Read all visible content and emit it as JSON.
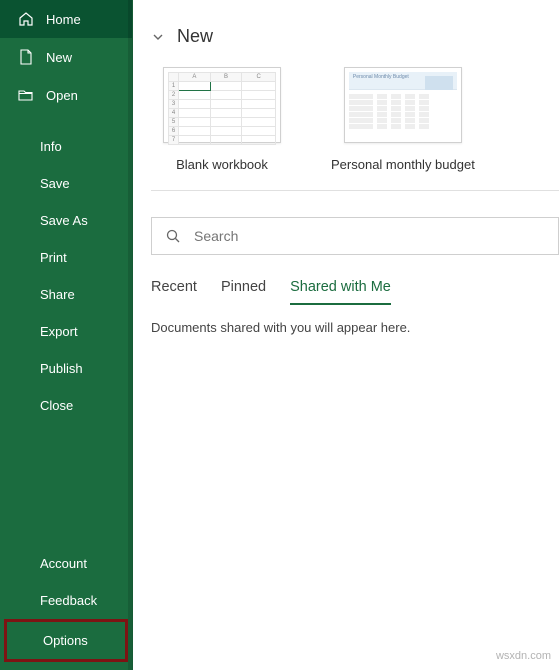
{
  "sidebar": {
    "home": "Home",
    "new": "New",
    "open": "Open",
    "info": "Info",
    "save": "Save",
    "save_as": "Save As",
    "print": "Print",
    "share": "Share",
    "export": "Export",
    "publish": "Publish",
    "close": "Close",
    "account": "Account",
    "feedback": "Feedback",
    "options": "Options"
  },
  "main": {
    "section_title": "New",
    "templates": {
      "blank": "Blank workbook",
      "budget": "Personal monthly budget"
    },
    "search_placeholder": "Search",
    "tabs": {
      "recent": "Recent",
      "pinned": "Pinned",
      "shared": "Shared with Me"
    },
    "empty_message": "Documents shared with you will appear here."
  },
  "watermark": "wsxdn.com"
}
